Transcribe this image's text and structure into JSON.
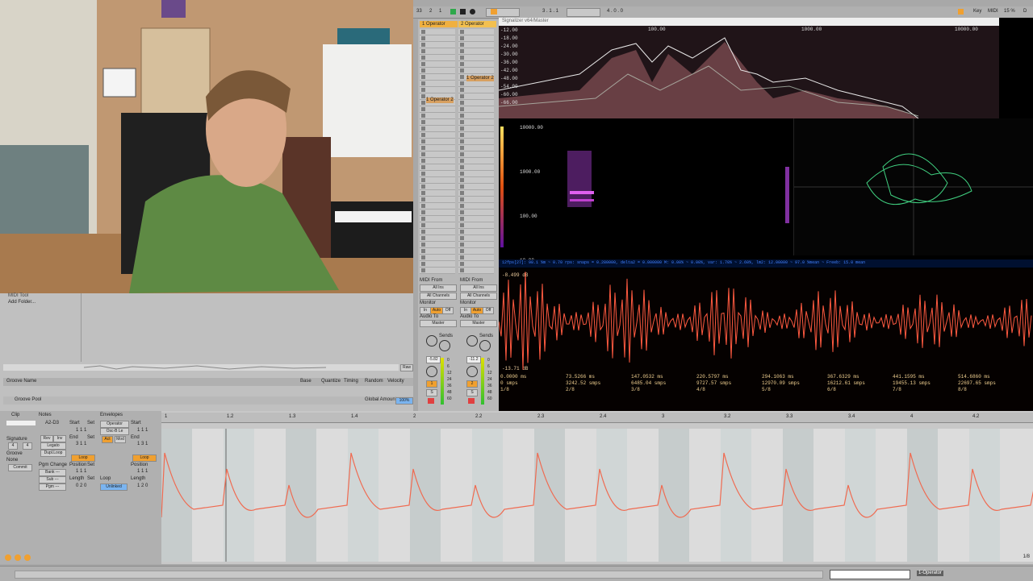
{
  "transport": {
    "tempo_val": "33",
    "bar1": "2",
    "bar2": "1",
    "position": "3 . 1 . 1",
    "end": "4 . 0 . 0",
    "key_label": "Key",
    "midi_label": "MIDI",
    "cpu": "15 %",
    "d_label": "D"
  },
  "tracks": [
    {
      "name": "1 Operator"
    },
    {
      "name": "2 Operator"
    }
  ],
  "clip_slots": {
    "track1_clip": "1 Operator 2",
    "track2_clip": "1 Operator 2"
  },
  "io": {
    "midi_from": "MIDI From",
    "all_ins": "All Ins",
    "all_channels": "All Channels",
    "monitor": "Monitor",
    "mon_in": "In",
    "mon_auto": "Auto",
    "mon_off": "Off",
    "audio_to": "Audio To",
    "master": "Master",
    "sends": "Sends",
    "vol1": "-5.82",
    "vol2": "-11.2",
    "track_num1": "1",
    "track_num2": "2",
    "s": "S",
    "db_ticks": [
      "0",
      "6",
      "12",
      "24",
      "36",
      "48",
      "60"
    ]
  },
  "scope": {
    "title": "Signalizer v64/Master",
    "db_labels": [
      "-12.00",
      "-18.00",
      "-24.00",
      "-30.00",
      "-36.00",
      "-42.00",
      "-48.00",
      "-54.00",
      "-60.00",
      "-66.00"
    ],
    "freq_labels": [
      "100.00",
      "1000.00",
      "10000.00"
    ],
    "spec_labels": [
      "10000.00",
      "1000.00",
      "100.00",
      "10.00"
    ],
    "status_line": "12fps[27]: 98.1 %m ~ 0.70 rps: snaps = 0.280000, delta2 = 0.000000 M: 0.00% ~ 0.00%, var: 1.70% ~ 2.60%, lm2: 12.00000 ~ 97.0 %mean ~ Freeb: 15.0 mean",
    "osc_db_top": "-8.499 dB",
    "osc_db_bot": "-13.71 dB",
    "time_ticks": [
      {
        "ms": "0.0000 ms",
        "smps": "0 smps",
        "frac": "1/8"
      },
      {
        "ms": "73.5266 ms",
        "smps": "3242.52 smps",
        "frac": "2/8"
      },
      {
        "ms": "147.0532 ms",
        "smps": "6485.04 smps",
        "frac": "3/8"
      },
      {
        "ms": "220.5797 ms",
        "smps": "9727.57 smps",
        "frac": "4/8"
      },
      {
        "ms": "294.1063 ms",
        "smps": "12970.09 smps",
        "frac": "5/8"
      },
      {
        "ms": "367.6329 ms",
        "smps": "16212.61 smps",
        "frac": "6/8"
      },
      {
        "ms": "441.1595 ms",
        "smps": "19455.13 smps",
        "frac": "7/8"
      },
      {
        "ms": "514.6860 ms",
        "smps": "22697.65 smps",
        "frac": "8/8"
      }
    ]
  },
  "browser": {
    "items": [
      "MIDI Tool",
      "Add Folder..."
    ],
    "raw_label": "Raw"
  },
  "groove": {
    "col_name": "Groove Name",
    "col_base": "Base",
    "col_quantize": "Quantize",
    "col_timing": "Timing",
    "col_random": "Random",
    "col_velocity": "Velocity",
    "pool": "Groove Pool",
    "global_amount": "Global Amount",
    "global_val": "100%"
  },
  "clip": {
    "clip_title": "Clip",
    "signature": "Signature",
    "sig_num": "4",
    "sig_den": "4",
    "groove": "Groove",
    "groove_val": "None",
    "commit": "Commit",
    "notes_title": "Notes",
    "note_range": "A2-D3",
    "start": "Start",
    "set": "Set",
    "end": "End",
    "rev": "Rev",
    "inv": "Inv",
    "legato": "Legato",
    "dupl": "Dupl.Loop",
    "loop": "Loop",
    "position": "Position",
    "length": "Length",
    "pgm_change": "Pgm Change",
    "bank": "Bank ---",
    "sub": "Sub ---",
    "pgm": "Pgm ---",
    "start_val": "1 1 1",
    "end_val": "3 1 1",
    "len_val": "0 2 0",
    "env_title": "Envelopes",
    "env_device": "Operator",
    "env_param": "Osc-B Le",
    "env_start": "1 1 1",
    "env_end": "1 3 1",
    "env_pos": "1 1 1",
    "env_len": "1 2 0",
    "unlinked": "Unlinked",
    "e_start": "Start",
    "e_end": "End",
    "e_loop": "Loop",
    "e_pos": "Position",
    "e_len": "Length",
    "act": "Act",
    "mod": "Mod"
  },
  "ruler": [
    "1",
    "1.2",
    "1.3",
    "1.4",
    "2",
    "2.2",
    "2.3",
    "2.4",
    "3",
    "3.2",
    "3.3",
    "3.4",
    "4",
    "4.2"
  ],
  "envelope_page": "1/8",
  "status_bar": {
    "track_label": "1-Operator"
  }
}
